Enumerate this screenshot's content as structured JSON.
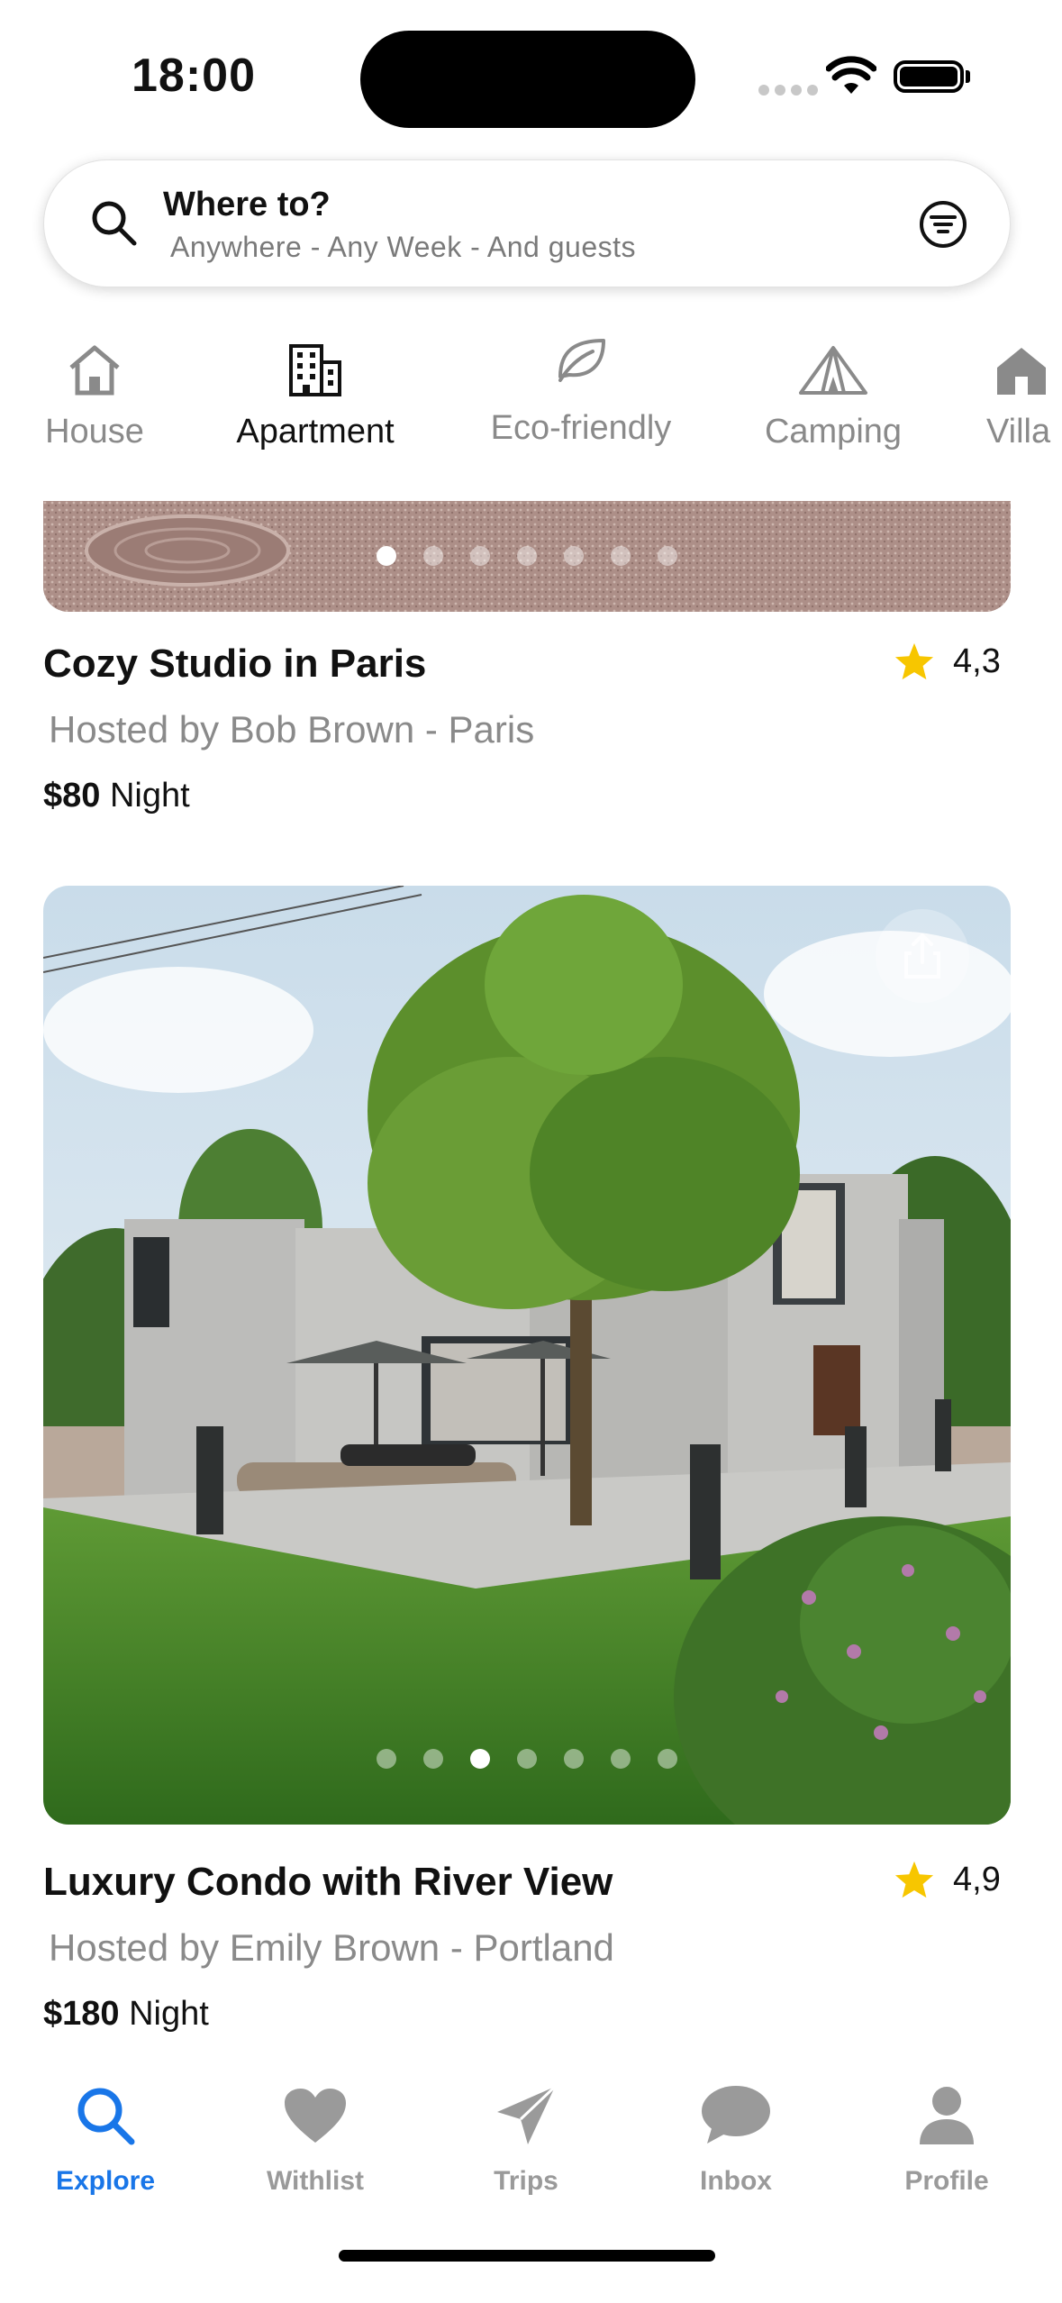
{
  "status_bar": {
    "time": "18:00"
  },
  "search": {
    "title": "Where to?",
    "subtitle": "Anywhere - Any Week - And guests"
  },
  "categories": [
    {
      "label": "House",
      "icon": "house-icon"
    },
    {
      "label": "Apartment",
      "icon": "building-icon",
      "selected": true
    },
    {
      "label": "Eco-friendly",
      "icon": "leaf-icon"
    },
    {
      "label": "Camping",
      "icon": "tent-icon"
    },
    {
      "label": "Villa",
      "icon": "villa-icon"
    }
  ],
  "listings": [
    {
      "title": "Cozy Studio in Paris",
      "rating": "4,3",
      "host": "Hosted by Bob Brown - Paris",
      "price": "$80",
      "unit": "Night",
      "photo_count": 7,
      "photo_index": 1
    },
    {
      "title": "Luxury Condo with River View",
      "rating": "4,9",
      "host": "Hosted by Emily Brown - Portland",
      "price": "$180",
      "unit": "Night",
      "photo_count": 7,
      "photo_index": 3
    }
  ],
  "tabbar": [
    {
      "label": "Explore",
      "icon": "search-icon",
      "active": true
    },
    {
      "label": "Withlist",
      "icon": "heart-icon"
    },
    {
      "label": "Trips",
      "icon": "paper-plane-icon"
    },
    {
      "label": "Inbox",
      "icon": "chat-bubble-icon"
    },
    {
      "label": "Profile",
      "icon": "person-icon"
    }
  ],
  "colors": {
    "accent": "#1976e8",
    "star": "#f7c600",
    "inactive": "#9a9a9a"
  }
}
